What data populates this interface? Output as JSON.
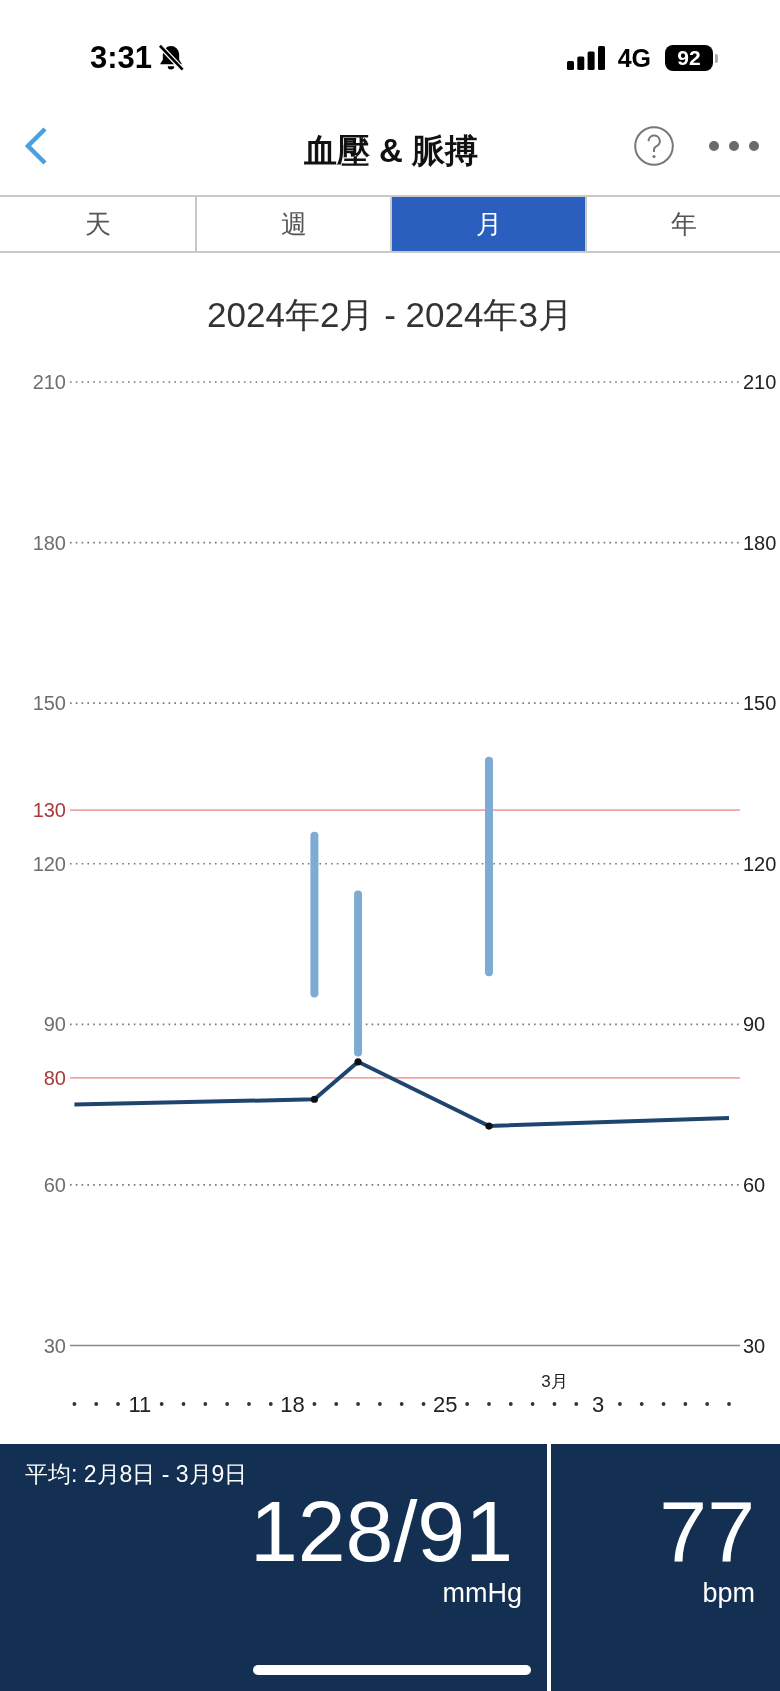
{
  "status_bar": {
    "time": "3:31",
    "silent": true,
    "network": "4G",
    "battery": "92"
  },
  "header": {
    "title": "血壓 & 脈搏"
  },
  "tabs": [
    {
      "label": "天",
      "selected": false
    },
    {
      "label": "週",
      "selected": false
    },
    {
      "label": "月",
      "selected": true
    },
    {
      "label": "年",
      "selected": false
    }
  ],
  "chart": {
    "title": "2024年2月 - 2024年3月",
    "right_axis_labels": [
      "210",
      "180",
      "150",
      "120",
      "90",
      "60",
      "30"
    ],
    "chart_data": {
      "type": "line",
      "grid": true,
      "ylim": [
        30,
        210
      ],
      "yticks": [
        30,
        60,
        90,
        120,
        150,
        180,
        210
      ],
      "categories": [
        null,
        null,
        null,
        "11",
        null,
        null,
        null,
        null,
        null,
        null,
        "18",
        null,
        null,
        null,
        null,
        null,
        null,
        "25",
        null,
        null,
        null,
        null,
        null,
        null,
        "3",
        null,
        null,
        null,
        null,
        null,
        null
      ],
      "series": [
        {
          "type": "candlestick",
          "color": "#7eabd3",
          "ohlc": [
            null,
            null,
            null,
            null,
            null,
            null,
            null,
            null,
            null,
            null,
            null,
            [
              126,
              126,
              95,
              95
            ],
            null,
            [
              115,
              115,
              84,
              84
            ],
            null,
            null,
            null,
            null,
            null,
            [
              140,
              140,
              99,
              99
            ],
            null,
            null,
            null,
            null,
            null,
            null,
            null,
            null,
            null,
            null,
            null
          ]
        },
        {
          "color": "#1f446e",
          "values": [
            75,
            null,
            null,
            null,
            null,
            null,
            null,
            null,
            null,
            null,
            null,
            76,
            null,
            83,
            null,
            null,
            null,
            null,
            null,
            71,
            null,
            null,
            null,
            null,
            null,
            null,
            null,
            null,
            null,
            null,
            72.5
          ]
        }
      ],
      "ref_lines": [
        {
          "axis": "y",
          "value": 130,
          "label": "130"
        },
        {
          "axis": "y",
          "value": 80,
          "label": "80"
        }
      ],
      "annotations": [
        "3月"
      ]
    }
  },
  "summary": {
    "label": "平均: 2月8日 - 3月9日",
    "blood_pressure": "128/91",
    "pressure_unit": "mmHg",
    "pulse": "77",
    "pulse_unit": "bpm"
  }
}
